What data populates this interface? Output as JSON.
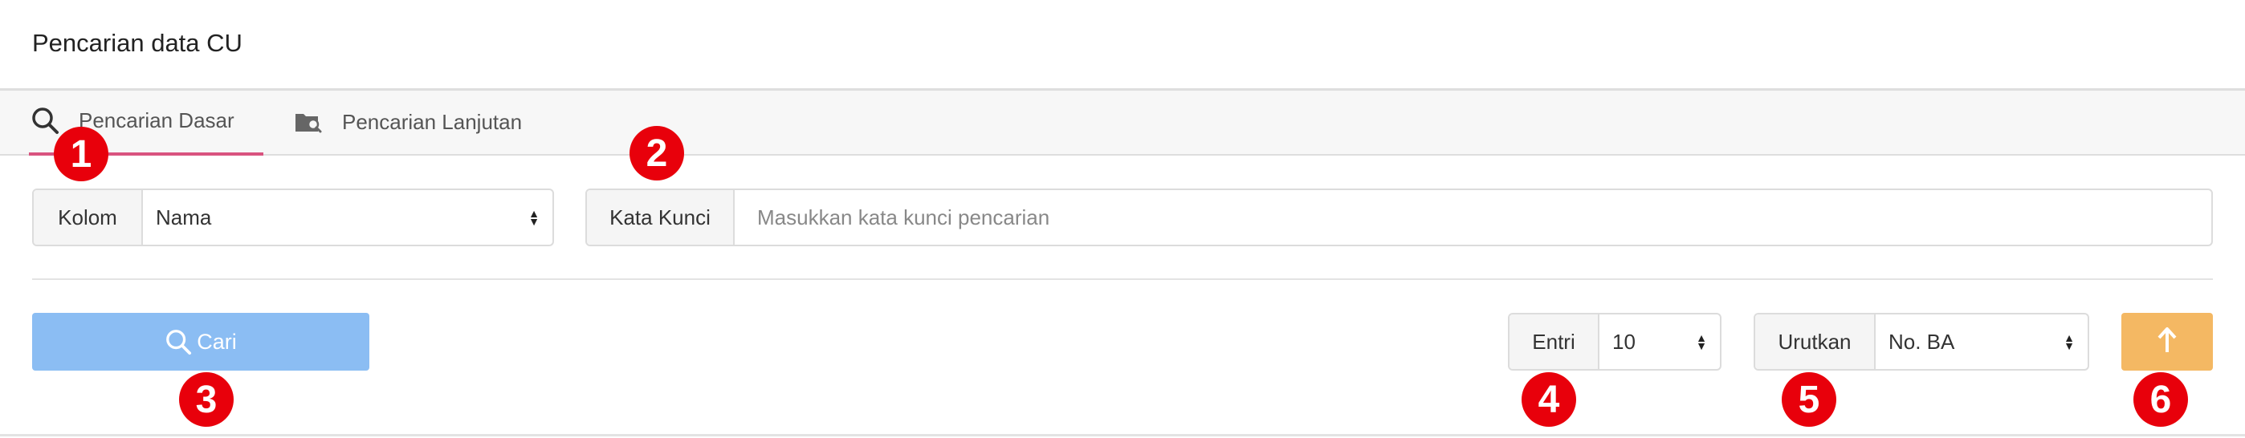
{
  "page": {
    "title": "Pencarian data CU"
  },
  "tabs": [
    {
      "label": "Pencarian Dasar",
      "icon": "search-icon",
      "active": true
    },
    {
      "label": "Pencarian Lanjutan",
      "icon": "folder-search-icon",
      "active": false
    }
  ],
  "filters": {
    "column": {
      "label": "Kolom",
      "value": "Nama"
    },
    "keyword": {
      "label": "Kata Kunci",
      "placeholder": "Masukkan kata kunci pencarian"
    },
    "entries": {
      "label": "Entri",
      "value": "10"
    },
    "sort": {
      "label": "Urutkan",
      "value": "No. BA"
    }
  },
  "buttons": {
    "search": {
      "label": "Cari",
      "icon": "search-icon",
      "color": "#8bbdf3"
    },
    "sort_direction": {
      "icon": "arrow-up-icon",
      "color": "#f4b863"
    }
  },
  "annotations": [
    "1",
    "2",
    "3",
    "4",
    "5",
    "6"
  ],
  "colors": {
    "active_tab_underline": "#d9537f",
    "badge": "#e8000b"
  }
}
